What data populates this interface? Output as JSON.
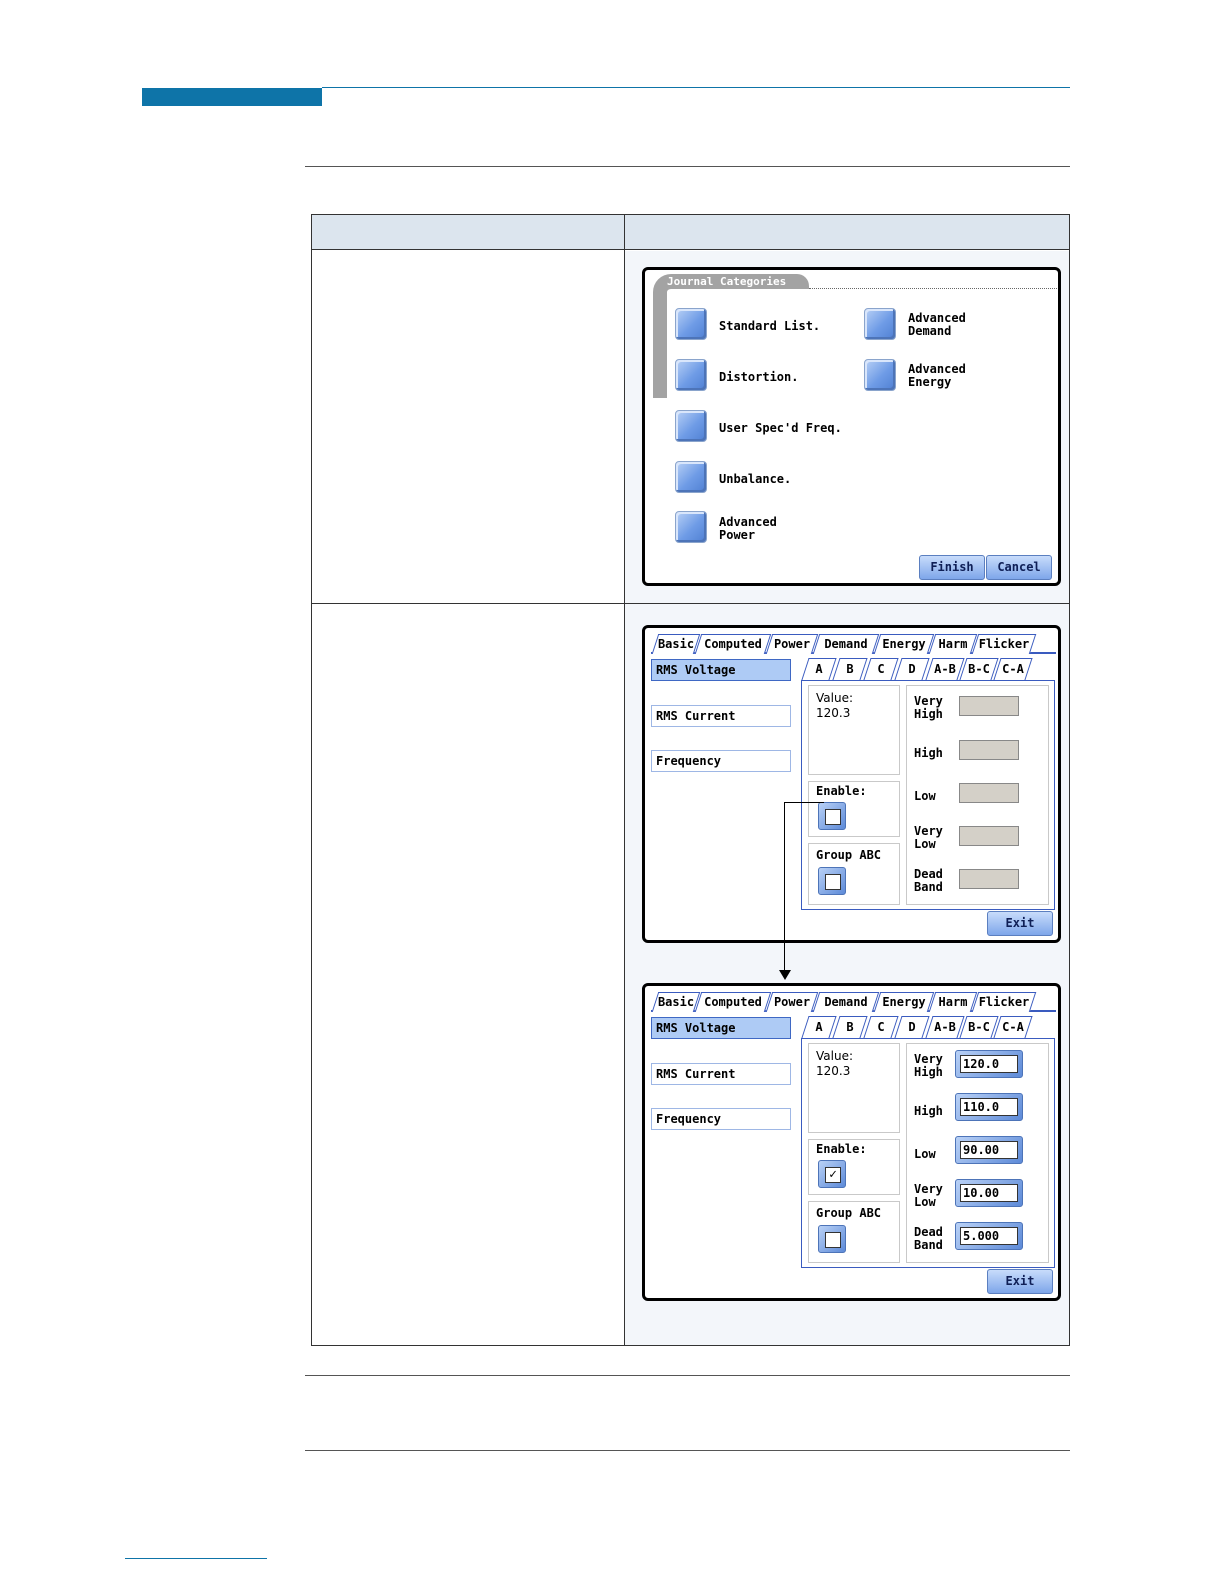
{
  "journal": {
    "title": "Journal Categories",
    "items_left": [
      "Standard List.",
      "Distortion.",
      "User Spec'd Freq.",
      "Unbalance.",
      "Advanced Power"
    ],
    "items_right": [
      "Advanced Demand",
      "Advanced Energy"
    ],
    "finish": "Finish",
    "cancel": "Cancel"
  },
  "limits": {
    "tabs": [
      "Basic",
      "Computed",
      "Power",
      "Demand",
      "Energy",
      "Harm",
      "Flicker"
    ],
    "left_tabs": [
      "RMS Voltage",
      "RMS Current",
      "Frequency"
    ],
    "subtabs": [
      "A",
      "B",
      "C",
      "D",
      "A-B",
      "B-C",
      "C-A"
    ],
    "value_label": "Value:",
    "value": "120.3",
    "enable_label": "Enable:",
    "group_label": "Group ABC",
    "limit_labels": [
      "Very High",
      "High",
      "Low",
      "Very Low",
      "Dead Band"
    ],
    "limit_values": [
      "120.0",
      "110.0",
      "90.00",
      "10.00",
      "5.000"
    ],
    "exit": "Exit",
    "check_mark": "✓"
  }
}
